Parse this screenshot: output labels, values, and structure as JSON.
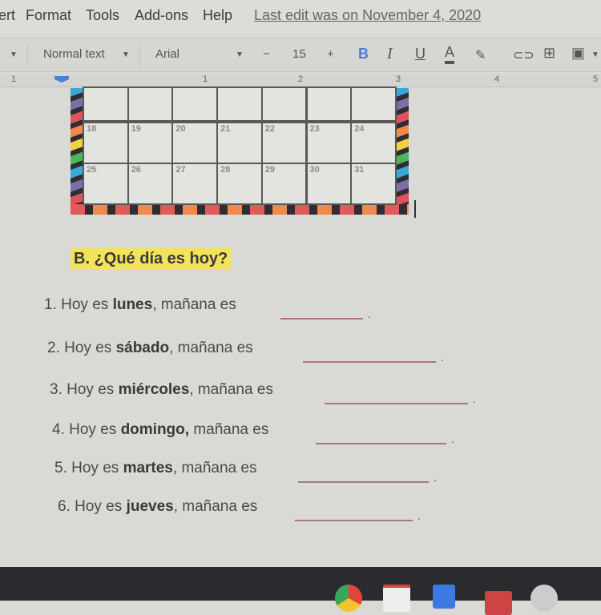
{
  "menu": {
    "items": [
      "ert",
      "Format",
      "Tools",
      "Add-ons",
      "Help"
    ],
    "last_edit": "Last edit was on November 4, 2020"
  },
  "toolbar": {
    "style": "Normal text",
    "font": "Arial",
    "minus": "−",
    "font_size": "15",
    "plus": "+",
    "bold": "B",
    "italic": "I",
    "underline": "U",
    "text_color": "A",
    "accent": "#4a7fd6"
  },
  "ruler": {
    "labels": [
      "1",
      "1",
      "2",
      "3",
      "4",
      "5"
    ]
  },
  "calendar": {
    "rows": [
      [
        "",
        "",
        "",
        "",
        "",
        "",
        ""
      ],
      [
        "18",
        "19",
        "20",
        "21",
        "22",
        "23",
        "24"
      ],
      [
        "25",
        "26",
        "27",
        "28",
        "29",
        "30",
        "31"
      ]
    ]
  },
  "document": {
    "heading": "B. ¿Qué día es hoy?",
    "questions": [
      {
        "num": "1.",
        "pre": "Hoy es",
        "day": "lunes",
        "post": ", mañana es"
      },
      {
        "num": "2.",
        "pre": "Hoy es",
        "day": "sábado",
        "post": ", mañana es"
      },
      {
        "num": "3.",
        "pre": "Hoy es",
        "day": "miércoles",
        "post": ", mañana es"
      },
      {
        "num": "4.",
        "pre": "Hoy es",
        "day": "domingo,",
        "post": " mañana es"
      },
      {
        "num": "5.",
        "pre": "Hoy es",
        "day": "martes",
        "post": ", mañana es"
      },
      {
        "num": "6.",
        "pre": "Hoy es",
        "day": "jueves",
        "post": ", mañana es"
      }
    ],
    "period": "."
  },
  "taskbar": {
    "apps": [
      "chrome-icon",
      "gmail-icon",
      "docs-icon",
      "app-icon",
      "app-icon"
    ]
  }
}
